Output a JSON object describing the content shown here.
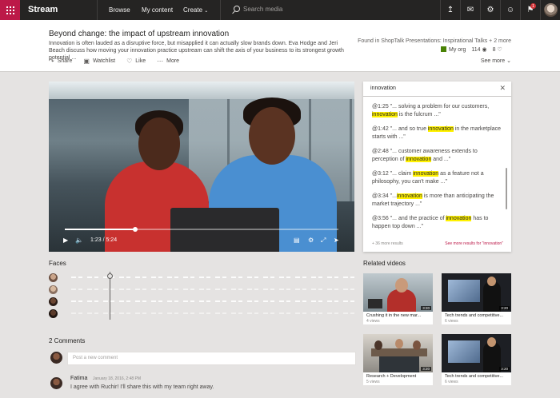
{
  "app": {
    "name": "Stream"
  },
  "nav": {
    "browse": "Browse",
    "my_content": "My content",
    "create": "Create",
    "search_placeholder": "Search media",
    "notification_count": "1"
  },
  "video": {
    "title": "Beyond change: the impact of upstream innovation",
    "description": "Innovation is often lauded as a disruptive force, but misapplied it can actually slow brands down. Eva Hodge and Jeri Beach discuss how moving your innovation practice upstream can shift the axis of your business to its strongest growth potential ...",
    "found_in": "Found in ShopTalk Presentations: Inspirational Talks + 2 more",
    "org": "My org",
    "views": "114",
    "likes": "8",
    "see_more": "See more",
    "current_time": "1:23",
    "duration": "5:24",
    "progress": 0.256
  },
  "actions": {
    "share": "Share",
    "watchlist": "Watchlist",
    "like": "Like",
    "more": "More"
  },
  "transcript": {
    "query": "innovation",
    "results": [
      {
        "ts": "@1:25",
        "pre": " \"... solving a problem for our customers, ",
        "hit": "innovation",
        "post": " is the fulcrum ...\""
      },
      {
        "ts": "@1:42",
        "pre": " \"... and so true ",
        "hit": "innovation",
        "post": " in the marketplace starts with ...\""
      },
      {
        "ts": "@2:48",
        "pre": " \"... customer awareness extends to perception of ",
        "hit": "innovation",
        "post": " and ...\""
      },
      {
        "ts": "@3:12",
        "pre": " \"... claim ",
        "hit": "innovation",
        "post": " as a feature not a philosophy, you can't make ...\""
      },
      {
        "ts": "@3:34",
        "pre": " \"...",
        "hit": "innovation",
        "post": " is more than anticipating the market trajectory ...\""
      },
      {
        "ts": "@3:56",
        "pre": " \"... and the practice of ",
        "hit": "innovation",
        "post": " has to happen top down ...\""
      }
    ],
    "more_results": "+ 36 more results",
    "see_more_results": "See more results for \"innovation\""
  },
  "faces": {
    "title": "Faces"
  },
  "comments": {
    "title": "2 Comments",
    "placeholder": "Post a new comment",
    "items": [
      {
        "author": "Fatima",
        "date": "January 18, 2016, 2:48 PM",
        "text": "I agree with Ruchir! I'll share this with my team right away."
      }
    ]
  },
  "related": {
    "title": "Related videos",
    "items": [
      {
        "title": "Crushing it in the new mar...",
        "views": "4 views",
        "duration": "3:20"
      },
      {
        "title": "Tech trends and competitive...",
        "views": "6 views",
        "duration": "3:20"
      },
      {
        "title": "Research + Development",
        "views": "5 views",
        "duration": "3:20"
      },
      {
        "title": "Tech trends and competitive...",
        "views": "6 views",
        "duration": "3:20"
      }
    ]
  },
  "colors": {
    "brand": "#bc1948",
    "highlight": "#fff100"
  }
}
